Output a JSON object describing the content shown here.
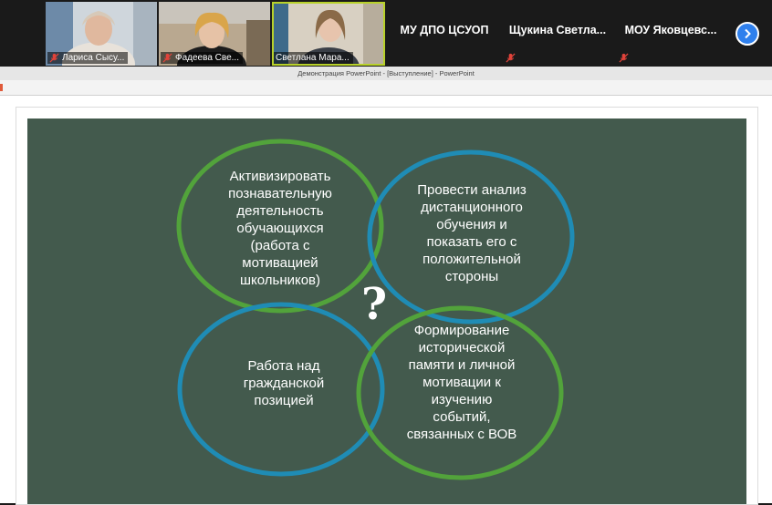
{
  "participants": [
    {
      "name": "Лариса Сысу...",
      "has_video": true,
      "muted": true
    },
    {
      "name": "Фадеева Све...",
      "has_video": true,
      "muted": true
    },
    {
      "name": "Светлана Мара...",
      "has_video": true,
      "muted": false,
      "active_speaker": true
    },
    {
      "name": "МУ ДПО ЦСУОП",
      "has_video": false,
      "muted": false
    },
    {
      "name": "Щукина  Светла...",
      "has_video": false,
      "muted": true
    },
    {
      "name": "МОУ  Яковцевс...",
      "has_video": false,
      "muted": true
    }
  ],
  "window": {
    "title": "Демонстрация PowerPoint - [Выступление] - PowerPoint"
  },
  "slide": {
    "background": "#435a4d",
    "ring_green": "#52a33b",
    "ring_blue": "#1f8cb5",
    "center_symbol": "?",
    "circles": [
      {
        "text": "Активизировать\nпознавательную\nдеятельность\nобучающихся\n(работа с\nмотивацией\nшкольников)",
        "color": "green"
      },
      {
        "text": "Провести анализ\nдистанционного\nобучения и\nпоказать его с\nположительной\nстороны",
        "color": "blue"
      },
      {
        "text": "Работа над\nгражданской\nпозицией",
        "color": "blue"
      },
      {
        "text": "Формирование\nисторической\nпамяти и личной\nмотивации к\nизучению\nсобытий,\nсвязанных с ВОВ",
        "color": "green"
      }
    ]
  }
}
